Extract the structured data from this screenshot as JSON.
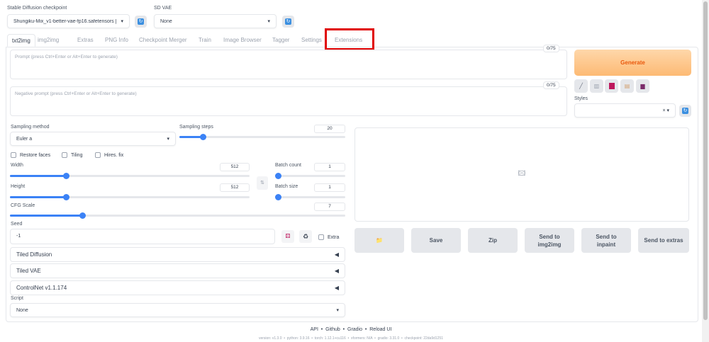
{
  "top": {
    "checkpoint_label": "Stable Diffusion checkpoint",
    "checkpoint_value": "Shungiku-Mix_v1-better-vae-fp16.safetensors [2",
    "vae_label": "SD VAE",
    "vae_value": "None"
  },
  "tabs": [
    {
      "label": "txt2img"
    },
    {
      "label": "img2img"
    },
    {
      "label": "Extras"
    },
    {
      "label": "PNG Info"
    },
    {
      "label": "Checkpoint Merger"
    },
    {
      "label": "Train"
    },
    {
      "label": "Image Browser"
    },
    {
      "label": "Tagger"
    },
    {
      "label": "Settings"
    },
    {
      "label": "Extensions"
    }
  ],
  "highlight_color": "#e00000",
  "prompt": {
    "placeholder": "Prompt (press Ctrl+Enter or Alt+Enter to generate)",
    "counter": "0/75"
  },
  "negative_prompt": {
    "placeholder": "Negative prompt (press Ctrl+Enter or Alt+Enter to generate)",
    "counter": "0/75"
  },
  "generate": {
    "label": "Generate",
    "color": "#f97316"
  },
  "tools": [
    "pencil-icon",
    "trash-icon",
    "bookmark-icon",
    "clipboard-icon",
    "save-icon"
  ],
  "styles": {
    "label": "Styles",
    "clear": "×"
  },
  "sampling": {
    "method_label": "Sampling method",
    "method_value": "Euler a",
    "steps_label": "Sampling steps",
    "steps_value": "20",
    "steps": 20
  },
  "checkboxes": {
    "restore_faces": "Restore faces",
    "tiling": "Tiling",
    "hires_fix": "Hires. fix"
  },
  "width": {
    "label": "Width",
    "value": "512"
  },
  "height": {
    "label": "Height",
    "value": "512"
  },
  "batch_count": {
    "label": "Batch count",
    "value": "1"
  },
  "batch_size": {
    "label": "Batch size",
    "value": "1"
  },
  "cfg": {
    "label": "CFG Scale",
    "value": "7"
  },
  "seed": {
    "label": "Seed",
    "value": "-1",
    "extra": "Extra"
  },
  "accordions": [
    {
      "label": "Tiled Diffusion"
    },
    {
      "label": "Tiled VAE"
    },
    {
      "label": "ControlNet v1.1.174"
    }
  ],
  "script": {
    "label": "Script",
    "value": "None"
  },
  "output_buttons": {
    "folder": "📁",
    "save": "Save",
    "zip": "Zip",
    "img2img": "Send to img2img",
    "inpaint": "Send to inpaint",
    "extras": "Send to extras"
  },
  "footer": {
    "links": [
      "API",
      "Github",
      "Gradio",
      "Reload UI"
    ],
    "version": "version: v1.3.0  •  python: 3.9.16  •  torch: 1.12.1+cu116  •  xformers: N/A  •  gradio: 3.31.0  •  checkpoint: 22da9d1251"
  }
}
